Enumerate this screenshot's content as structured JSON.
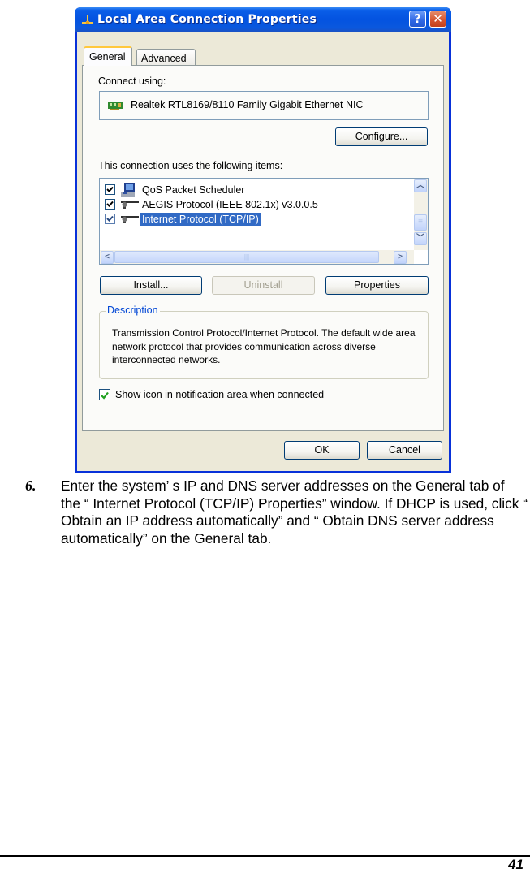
{
  "dialog": {
    "title": "Local Area Connection Properties",
    "title_icon": "network-connection-icon",
    "help_button": "?",
    "close_button": "✕",
    "tabs": [
      {
        "label": "General",
        "active": true
      },
      {
        "label": "Advanced",
        "active": false
      }
    ],
    "connect_using_label": "Connect using:",
    "adapter_name": "Realtek RTL8169/8110 Family Gigabit Ethernet NIC",
    "configure_button": "Configure...",
    "items_label": "This connection uses the following items:",
    "items": [
      {
        "label": "QoS Packet Scheduler",
        "checked": true,
        "icon": "scheduler-icon",
        "selected": false
      },
      {
        "label": "AEGIS Protocol (IEEE 802.1x) v3.0.0.5",
        "checked": true,
        "icon": "protocol-icon",
        "selected": false
      },
      {
        "label": "Internet Protocol (TCP/IP)",
        "checked": true,
        "icon": "protocol-icon",
        "selected": true
      }
    ],
    "install_button": "Install...",
    "uninstall_button": "Uninstall",
    "properties_button": "Properties",
    "description_legend": "Description",
    "description_text": "Transmission Control Protocol/Internet Protocol. The default wide area network protocol that provides communication across diverse interconnected networks.",
    "show_icon_label": "Show icon in notification area when connected",
    "show_icon_checked": true,
    "ok_button": "OK",
    "cancel_button": "Cancel"
  },
  "document": {
    "step_number": "6.",
    "step_text": "Enter the system’ s IP and DNS server addresses on the General tab of the “ Internet Protocol (TCP/IP) Properties” window.  If DHCP is used, click “ Obtain an IP address automatically”  and “ Obtain DNS server address automatically” on the General tab.",
    "page_number": "41"
  },
  "colors": {
    "titlebar": "#0453e0",
    "dialog_face": "#ece9d8",
    "selection": "#316ac5",
    "legend_text": "#0046d5"
  }
}
